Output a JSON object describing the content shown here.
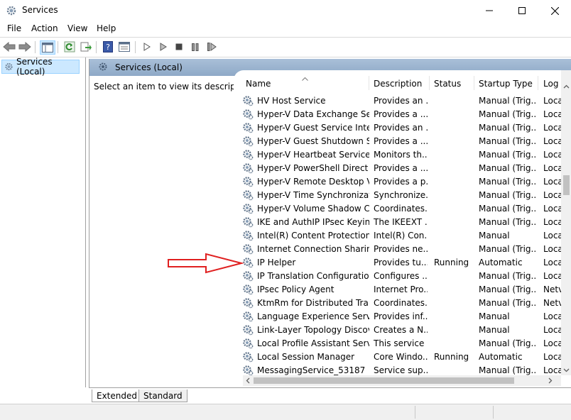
{
  "window": {
    "title": "Services"
  },
  "menu": [
    "File",
    "Action",
    "View",
    "Help"
  ],
  "toolbar": {
    "buttons": [
      "back-arrow-icon",
      "forward-arrow-icon",
      "show-hide-console-tree-icon",
      "refresh-icon",
      "export-list-icon",
      "help-icon",
      "properties-icon",
      "start-service-icon",
      "start-service-alt-icon",
      "stop-service-icon",
      "pause-service-icon",
      "restart-service-icon"
    ]
  },
  "tree": {
    "selected": "Services (Local)"
  },
  "content": {
    "header": "Services (Local)",
    "description_hint": "Select an item to view its description."
  },
  "columns": [
    "Name",
    "Description",
    "Status",
    "Startup Type",
    "Log"
  ],
  "rows": [
    {
      "name": "HV Host Service",
      "description": "Provides an ...",
      "status": "",
      "startup": "Manual (Trig...",
      "logon": "Loca"
    },
    {
      "name": "Hyper-V Data Exchange Ser...",
      "description": "Provides a ...",
      "status": "",
      "startup": "Manual (Trig...",
      "logon": "Loca"
    },
    {
      "name": "Hyper-V Guest Service Inter...",
      "description": "Provides an ...",
      "status": "",
      "startup": "Manual (Trig...",
      "logon": "Loca"
    },
    {
      "name": "Hyper-V Guest Shutdown S...",
      "description": "Provides a ...",
      "status": "",
      "startup": "Manual (Trig...",
      "logon": "Loca"
    },
    {
      "name": "Hyper-V Heartbeat Service",
      "description": "Monitors th...",
      "status": "",
      "startup": "Manual (Trig...",
      "logon": "Loca"
    },
    {
      "name": "Hyper-V PowerShell Direct ...",
      "description": "Provides a ...",
      "status": "",
      "startup": "Manual (Trig...",
      "logon": "Loca"
    },
    {
      "name": "Hyper-V Remote Desktop Vi...",
      "description": "Provides a p...",
      "status": "",
      "startup": "Manual (Trig...",
      "logon": "Loca"
    },
    {
      "name": "Hyper-V Time Synchronizati...",
      "description": "Synchronize...",
      "status": "",
      "startup": "Manual (Trig...",
      "logon": "Loca"
    },
    {
      "name": "Hyper-V Volume Shadow C...",
      "description": "Coordinates...",
      "status": "",
      "startup": "Manual (Trig...",
      "logon": "Loca"
    },
    {
      "name": "IKE and AuthIP IPsec Keying...",
      "description": "The IKEEXT ...",
      "status": "",
      "startup": "Manual (Trig...",
      "logon": "Loca"
    },
    {
      "name": "Intel(R) Content Protection ...",
      "description": "Intel(R) Con...",
      "status": "",
      "startup": "Manual",
      "logon": "Loca"
    },
    {
      "name": "Internet Connection Sharin...",
      "description": "Provides ne...",
      "status": "",
      "startup": "Manual (Trig...",
      "logon": "Loca"
    },
    {
      "name": "IP Helper",
      "description": "Provides tu...",
      "status": "Running",
      "startup": "Automatic",
      "logon": "Loca"
    },
    {
      "name": "IP Translation Configuration...",
      "description": "Configures ...",
      "status": "",
      "startup": "Manual (Trig...",
      "logon": "Loca"
    },
    {
      "name": "IPsec Policy Agent",
      "description": "Internet Pro...",
      "status": "",
      "startup": "Manual (Trig...",
      "logon": "Netv"
    },
    {
      "name": "KtmRm for Distributed Tran...",
      "description": "Coordinates...",
      "status": "",
      "startup": "Manual (Trig...",
      "logon": "Netv"
    },
    {
      "name": "Language Experience Service",
      "description": "Provides inf...",
      "status": "",
      "startup": "Manual",
      "logon": "Loca"
    },
    {
      "name": "Link-Layer Topology Discov...",
      "description": "Creates a N...",
      "status": "",
      "startup": "Manual",
      "logon": "Loca"
    },
    {
      "name": "Local Profile Assistant Service",
      "description": "This service ...",
      "status": "",
      "startup": "Manual (Trig...",
      "logon": "Loca"
    },
    {
      "name": "Local Session Manager",
      "description": "Core Windo...",
      "status": "Running",
      "startup": "Automatic",
      "logon": "Loca"
    },
    {
      "name": "MessagingService_53187",
      "description": "Service sup...",
      "status": "",
      "startup": "Manual (Trig...",
      "logon": "Loca"
    }
  ],
  "tabs": [
    "Extended",
    "Standard"
  ],
  "colors": {
    "annotation_arrow": "#e02020",
    "header_band": "#9db5d0",
    "selection": "#cce8ff"
  }
}
